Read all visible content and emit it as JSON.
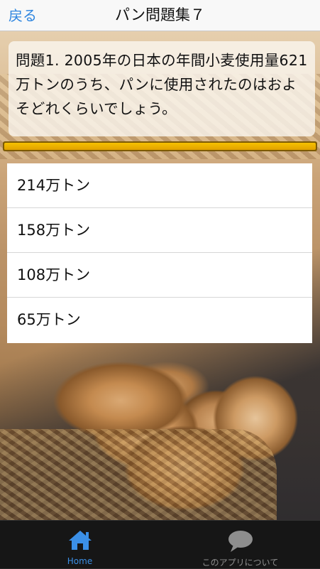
{
  "navbar": {
    "back_label": "戻る",
    "title": "パン問題集７"
  },
  "question": {
    "text": "問題1. 2005年の日本の年間小麦使用量621万トンのうち、パンに使用されたのはおよそどれくらいでしょう。"
  },
  "progress": {
    "fraction": 1.0
  },
  "answers": [
    {
      "label": "214万トン"
    },
    {
      "label": "158万トン"
    },
    {
      "label": "108万トン"
    },
    {
      "label": "65万トン"
    }
  ],
  "tabbar": {
    "items": [
      {
        "label": "Home",
        "icon": "home-icon",
        "selected": true
      },
      {
        "label": "このアプリについて",
        "icon": "speech-bubble-icon",
        "selected": false
      }
    ]
  },
  "colors": {
    "accent": "#2f86e0",
    "progress_fill": "#f7c200",
    "tabbar_bg": "#161616"
  }
}
